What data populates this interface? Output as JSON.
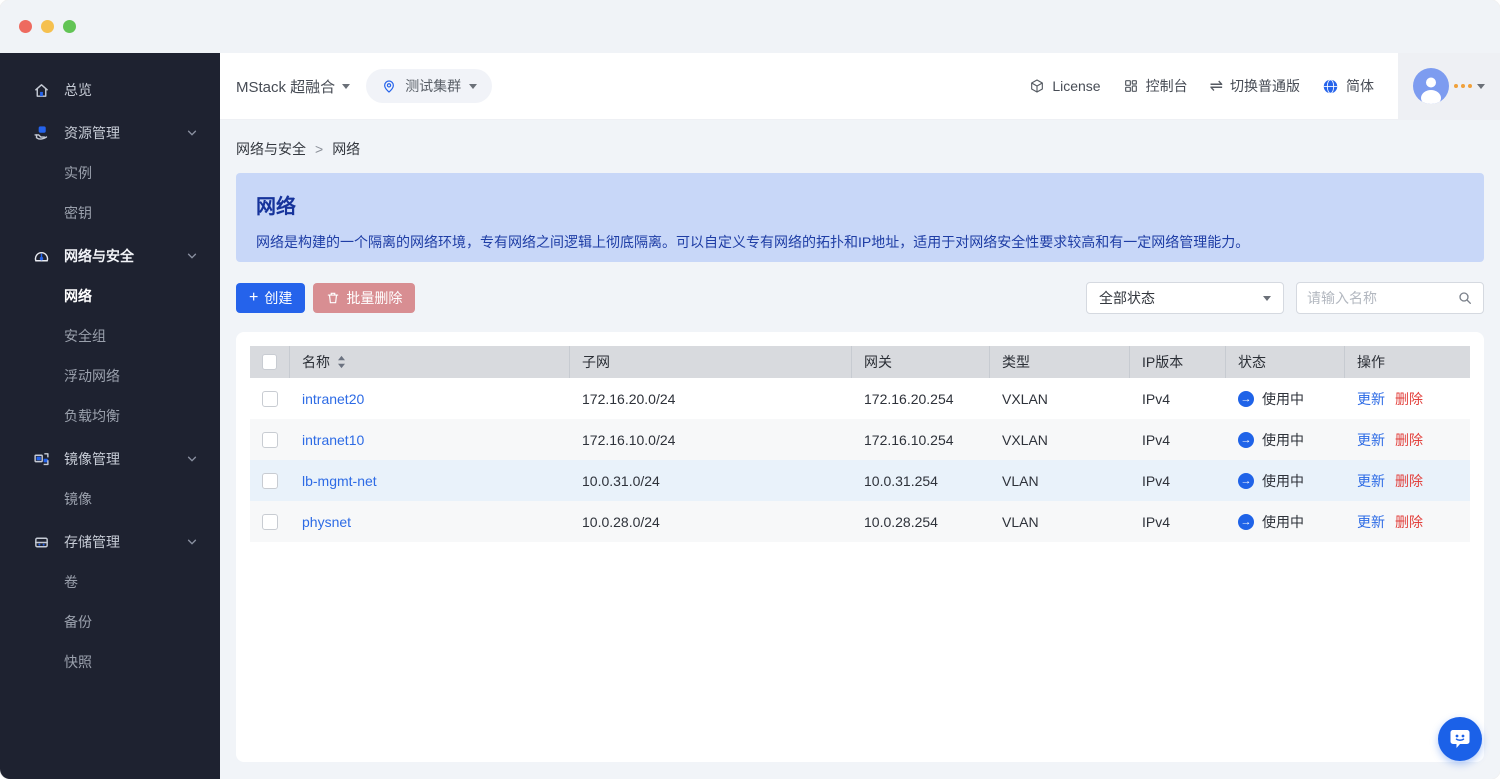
{
  "window": {
    "controls": {
      "close": "close",
      "minimize": "minimize",
      "maximize": "maximize"
    }
  },
  "sidebar": {
    "items": [
      {
        "label": "总览"
      },
      {
        "label": "资源管理"
      },
      {
        "label": "实例"
      },
      {
        "label": "密钥"
      },
      {
        "label": "网络与安全"
      },
      {
        "label": "网络"
      },
      {
        "label": "安全组"
      },
      {
        "label": "浮动网络"
      },
      {
        "label": "负载均衡"
      },
      {
        "label": "镜像管理"
      },
      {
        "label": "镜像"
      },
      {
        "label": "存储管理"
      },
      {
        "label": "卷"
      },
      {
        "label": "备份"
      },
      {
        "label": "快照"
      }
    ]
  },
  "topbar": {
    "brand": "MStack 超融合",
    "cluster": "测试集群",
    "license_label": "License",
    "console_label": "控制台",
    "switch_label": "切换普通版",
    "lang_label": "简体"
  },
  "breadcrumb": {
    "parent": "网络与安全",
    "separator": ">",
    "current": "网络"
  },
  "banner": {
    "title": "网络",
    "description": "网络是构建的一个隔离的网络环境，专有网络之间逻辑上彻底隔离。可以自定义专有网络的拓扑和IP地址，适用于对网络安全性要求较高和有一定网络管理能力。"
  },
  "toolbar": {
    "create_label": "创建",
    "batch_delete_label": "批量删除",
    "status_filter_value": "全部状态",
    "search_placeholder": "请输入名称"
  },
  "table": {
    "columns": [
      "名称",
      "子网",
      "网关",
      "类型",
      "IP版本",
      "状态",
      "操作"
    ],
    "op_update": "更新",
    "op_delete": "删除",
    "rows": [
      {
        "name": "intranet20",
        "subnet": "172.16.20.0/24",
        "gateway": "172.16.20.254",
        "type": "VXLAN",
        "ip_version": "IPv4",
        "status": "使用中"
      },
      {
        "name": "intranet10",
        "subnet": "172.16.10.0/24",
        "gateway": "172.16.10.254",
        "type": "VXLAN",
        "ip_version": "IPv4",
        "status": "使用中"
      },
      {
        "name": "lb-mgmt-net",
        "subnet": "10.0.31.0/24",
        "gateway": "10.0.31.254",
        "type": "VLAN",
        "ip_version": "IPv4",
        "status": "使用中"
      },
      {
        "name": "physnet",
        "subnet": "10.0.28.0/24",
        "gateway": "10.0.28.254",
        "type": "VLAN",
        "ip_version": "IPv4",
        "status": "使用中"
      }
    ]
  },
  "colors": {
    "primary": "#2563eb",
    "danger": "#e2403c",
    "disabled_danger": "#d88e92",
    "sidebar_bg": "#1e2230",
    "banner_bg": "#c8d7f8",
    "banner_text": "#16339b",
    "table_header_bg": "#d8dade",
    "row_hover_bg": "#e9f2fa",
    "status_icon_bg": "#1f63e8",
    "avatar_bg": "#7d9cf0",
    "ellipsis_orange": "#f0a13a",
    "chat_fab_bg": "#1b61e8"
  }
}
